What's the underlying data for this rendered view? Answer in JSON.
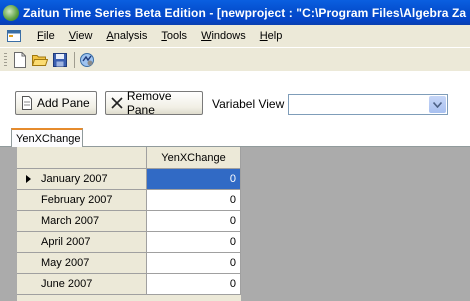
{
  "window": {
    "title": "Zaitun Time Series Beta Edition - [newproject : \"C:\\Program Files\\Algebra Za"
  },
  "menu": {
    "items": [
      {
        "label": "File",
        "underline": "F",
        "rest": "ile"
      },
      {
        "label": "View",
        "underline": "V",
        "rest": "iew"
      },
      {
        "label": "Analysis",
        "underline": "A",
        "rest": "nalysis"
      },
      {
        "label": "Tools",
        "underline": "T",
        "rest": "ools"
      },
      {
        "label": "Windows",
        "underline": "W",
        "rest": "indows"
      },
      {
        "label": "Help",
        "underline": "H",
        "rest": "elp"
      }
    ]
  },
  "toolbar": {
    "icons": [
      "new-file-icon",
      "open-folder-icon",
      "save-icon",
      "properties-icon"
    ]
  },
  "pane": {
    "add_label": "Add Pane",
    "remove_label": "Remove Pane",
    "variable_label": "Variabel View :",
    "variable_value": ""
  },
  "tab": {
    "label": "YenXChange"
  },
  "grid": {
    "column_header": "YenXChange",
    "rows": [
      {
        "label": "January 2007",
        "value": "0",
        "current": true
      },
      {
        "label": "February 2007",
        "value": "0",
        "current": false
      },
      {
        "label": "March 2007",
        "value": "0",
        "current": false
      },
      {
        "label": "April 2007",
        "value": "0",
        "current": false
      },
      {
        "label": "May 2007",
        "value": "0",
        "current": false
      },
      {
        "label": "June 2007",
        "value": "0",
        "current": false
      }
    ]
  },
  "colors": {
    "titlebar": "#0550d0",
    "selection": "#316ac5",
    "tab_accent": "#e68b2c",
    "grid_background": "#ababab"
  }
}
